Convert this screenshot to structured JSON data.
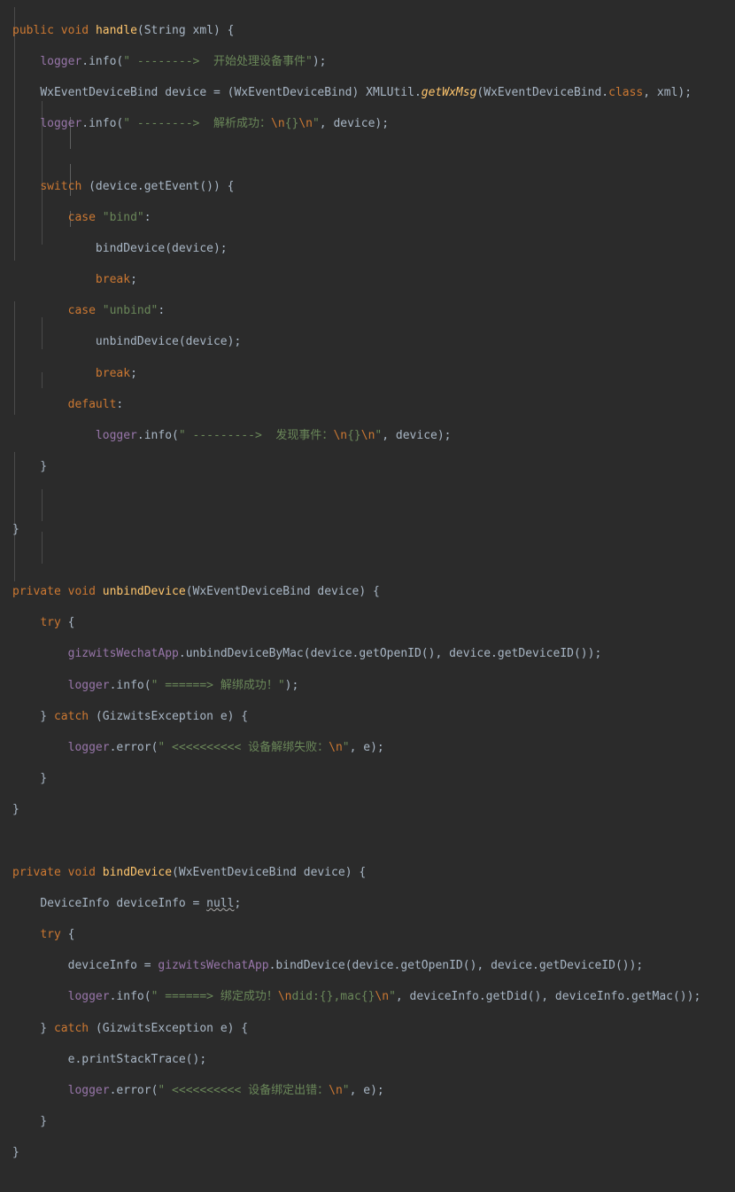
{
  "editor": {
    "theme": "darcula",
    "background": "#2b2b2b",
    "default_text_color": "#a9b7c6",
    "font_size_px": 13,
    "line_height_px": 17.6,
    "language": "java",
    "colors": {
      "keyword": "#cc7832",
      "method_declaration": "#ffc66d",
      "static_method": "#ffc66d",
      "field": "#9876aa",
      "string": "#6a8759",
      "escape_sequence": "#cc7832",
      "identifier": "#a9b7c6",
      "indent_guide": "#4a4a4a",
      "indent_guide_active": "#5e6060",
      "warning_squiggle": "#a9a9a9"
    },
    "indent_guides_visible": true
  },
  "code": {
    "total_lines": 38,
    "lines": [
      "public void handle(String xml) {",
      "    logger.info(\" -------->  开始处理设备事件\");",
      "    WxEventDeviceBind device = (WxEventDeviceBind) XMLUtil.getWxMsg(WxEventDeviceBind.class, xml);",
      "    logger.info(\" -------->  解析成功：\\n{}\\n\", device);",
      "",
      "    switch (device.getEvent()) {",
      "        case \"bind\":",
      "            bindDevice(device);",
      "            break;",
      "        case \"unbind\":",
      "            unbindDevice(device);",
      "            break;",
      "        default:",
      "            logger.info(\" --------->  发现事件：\\n{}\\n\", device);",
      "    }",
      "",
      "}",
      "",
      "private void unbindDevice(WxEventDeviceBind device) {",
      "    try {",
      "        gizwitsWechatApp.unbindDeviceByMac(device.getOpenID(), device.getDeviceID());",
      "        logger.info(\" ======> 解绑成功！\");",
      "    } catch (GizwitsException e) {",
      "        logger.error(\" <<<<<<<<<< 设备解绑失败：\\n\", e);",
      "    }",
      "}",
      "",
      "private void bindDevice(WxEventDeviceBind device) {",
      "    DeviceInfo deviceInfo = null;",
      "    try {",
      "        deviceInfo = gizwitsWechatApp.bindDevice(device.getOpenID(), device.getDeviceID());",
      "        logger.info(\" ======> 绑定成功！\\ndid:{},mac{}\\n\", deviceInfo.getDid(), deviceInfo.getMac());",
      "    } catch (GizwitsException e) {",
      "        e.printStackTrace();",
      "        logger.error(\" <<<<<<<<<< 设备绑定出错：\\n\", e);",
      "    }",
      "}"
    ],
    "tokens": {
      "keywords": [
        "public",
        "void",
        "private",
        "switch",
        "case",
        "break",
        "default",
        "try",
        "catch",
        "class"
      ],
      "method_declarations": [
        "handle",
        "unbindDevice",
        "bindDevice"
      ],
      "static_calls": [
        "getWxMsg"
      ],
      "fields": [
        "logger",
        "gizwitsWechatApp"
      ],
      "types": [
        "String",
        "WxEventDeviceBind",
        "XMLUtil",
        "GizwitsException",
        "DeviceInfo"
      ],
      "string_literals": [
        "\" -------->  开始处理设备事件\"",
        "\" -------->  解析成功：\\n{}\\n\"",
        "\"bind\"",
        "\"unbind\"",
        "\" --------->  发现事件：\\n{}\\n\"",
        "\" ======> 解绑成功！\"",
        "\" <<<<<<<<<< 设备解绑失败：\\n\"",
        "\" ======> 绑定成功！\\ndid:{},mac{}\\n\"",
        "\" <<<<<<<<<< 设备绑定出错：\\n\""
      ],
      "warning_tokens": [
        "null"
      ]
    }
  }
}
